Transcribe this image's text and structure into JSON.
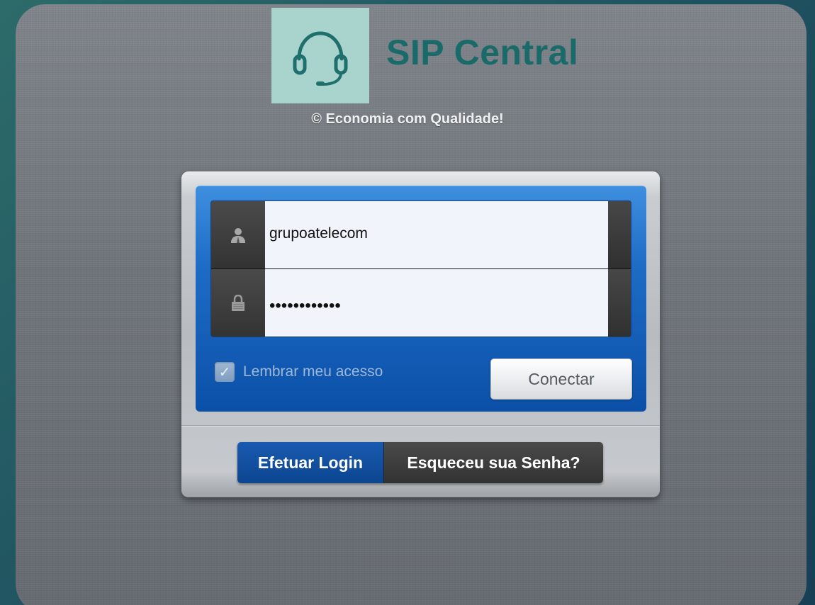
{
  "brand": {
    "name": "SIP Central",
    "tagline": "© Economia com Qualidade!",
    "logo_icon": "headset-icon",
    "colors": {
      "logo_bg": "#a9d3cd",
      "logo_text": "#1a6a6a",
      "accent_blue": "#0b50a8"
    }
  },
  "login": {
    "username": {
      "value": "grupoatelecom",
      "icon": "user-icon"
    },
    "password": {
      "value": "••••••••••••",
      "icon": "lock-icon"
    },
    "remember": {
      "label": "Lembrar meu acesso",
      "checked": true
    },
    "connect_label": "Conectar"
  },
  "tabs": [
    {
      "label": "Efetuar Login",
      "active": true
    },
    {
      "label": "Esqueceu sua Senha?",
      "active": false
    }
  ]
}
